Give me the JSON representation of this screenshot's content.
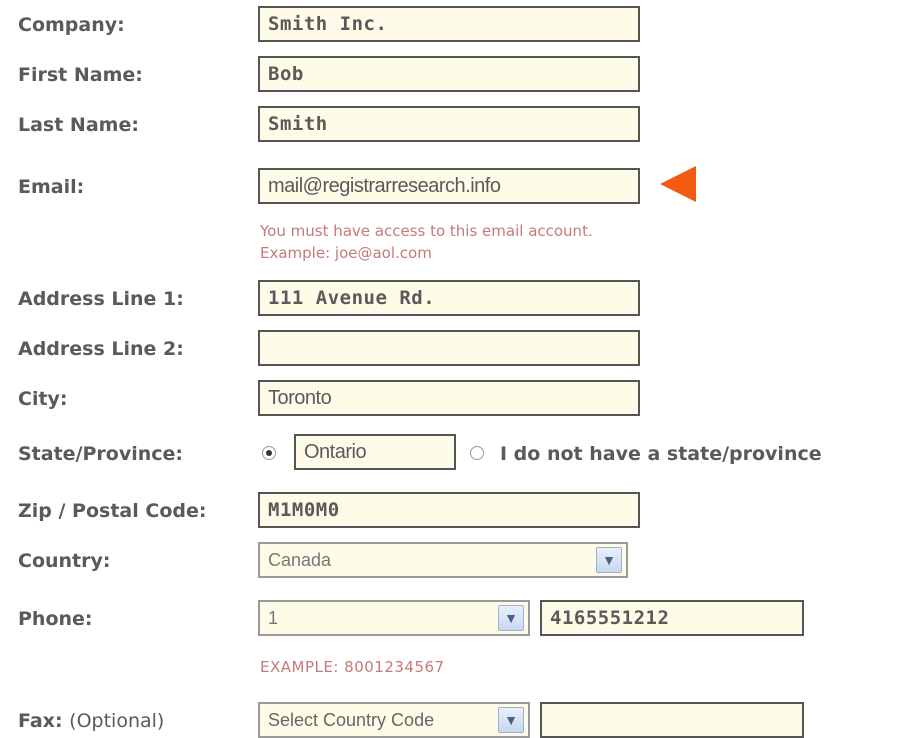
{
  "form": {
    "company": {
      "label": "Company:",
      "value": "Smith Inc."
    },
    "first_name": {
      "label": "First Name:",
      "value": "Bob"
    },
    "last_name": {
      "label": "Last Name:",
      "value": "Smith"
    },
    "email": {
      "label": "Email:",
      "value": "mail@registrarresearch.info",
      "hint_line1": "You must have access to this email account.",
      "hint_line2": "Example: joe@aol.com"
    },
    "address1": {
      "label": "Address Line 1:",
      "value": "111 Avenue Rd."
    },
    "address2": {
      "label": "Address Line 2:",
      "value": ""
    },
    "city": {
      "label": "City:",
      "value": "Toronto"
    },
    "state": {
      "label": "State/Province:",
      "value": "Ontario",
      "no_state_label": "I do not have a state/province"
    },
    "zip": {
      "label": "Zip / Postal Code:",
      "value": "M1M0M0"
    },
    "country": {
      "label": "Country:",
      "selected": "Canada"
    },
    "phone": {
      "label": "Phone:",
      "country_code": "1",
      "number": "4165551212",
      "example": "EXAMPLE: 8001234567"
    },
    "fax": {
      "label": "Fax:",
      "optional": "(Optional)",
      "country_code": "Select Country Code",
      "number": ""
    }
  },
  "colors": {
    "label": "#5a5a5a",
    "field_bg": "#fefce8",
    "hint": "#c47a7a",
    "arrow": "#f25a10"
  },
  "icons": {
    "dropdown": "chevron-down-icon",
    "pointer": "arrow-left-icon"
  }
}
